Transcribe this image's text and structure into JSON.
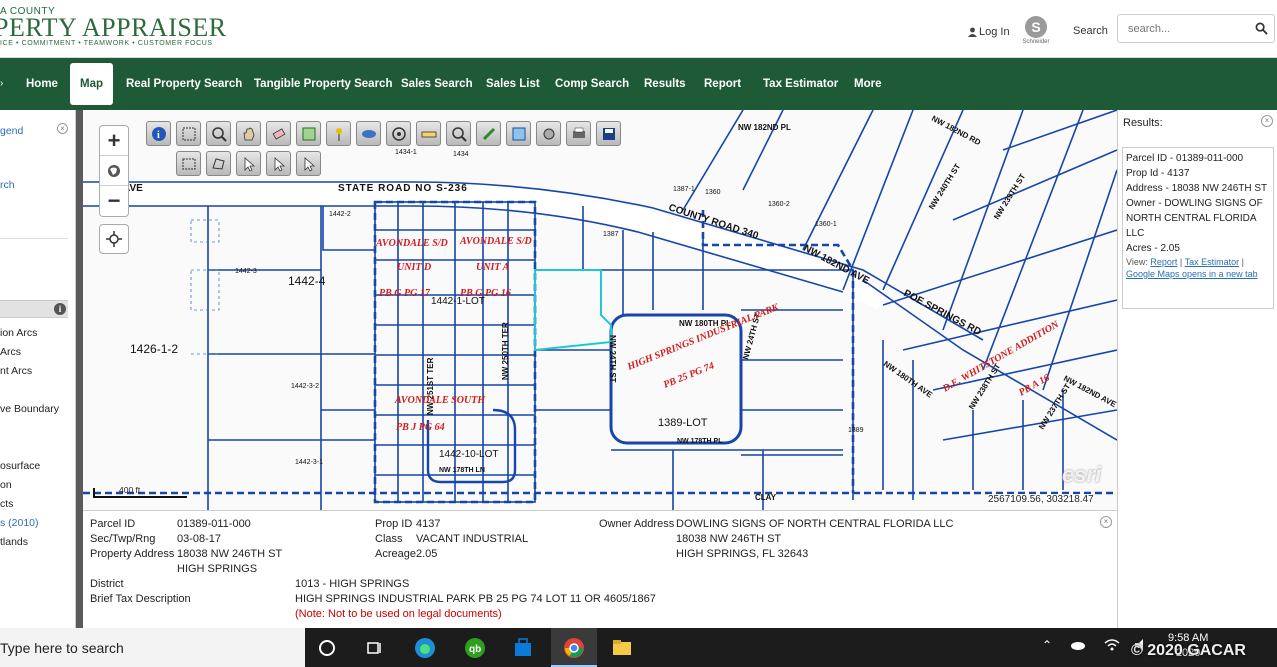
{
  "header": {
    "county": "A COUNTY",
    "title": "PERTY APPRAISER",
    "tagline": "ICE • COMMITMENT • TEAMWORK • CUSTOMER FOCUS",
    "login_label": "Log In",
    "search_label": "Search",
    "search_placeholder": "search..."
  },
  "nav": {
    "items": [
      "Home",
      "Map",
      "Real Property Search",
      "Tangible Property Search",
      "Sales Search",
      "Sales List",
      "Comp Search",
      "Results",
      "Report",
      "Tax Estimator",
      "More"
    ],
    "active": "Map"
  },
  "left_panel": {
    "items": [
      "gend",
      "rch",
      "ion Arcs",
      "Arcs",
      "nt Arcs",
      "ve Boundary",
      "osurface",
      "on",
      "cts",
      "s (2010)",
      "tlands"
    ]
  },
  "map": {
    "scale_label": "400 ft",
    "coordinates": "2567109.56, 303218.47",
    "attribution": "esri",
    "street_labels": [
      "STATE ROAD NO S-236",
      "COUNTY ROAD 340",
      "NW 182ND AVE",
      "POE SPRINGS RD",
      "NW 180TH PL",
      "NW 24TH ST",
      "NW 24TH ST",
      "NW 178TH PL",
      "NW 251ST TER",
      "NW 250TH TER",
      "NW 178TH LN",
      "NW 182ND PL",
      "NW 180TH AVE",
      "NW 182ND RD",
      "NW 240TH ST",
      "NW 239TH ST",
      "NW 238TH ST",
      "NW 237TH ST",
      "NW 182ND AVE",
      "AVE",
      "CLAY"
    ],
    "subdivision_labels": [
      "AVONDALE S/D",
      "AVONDALE S/D",
      "UNIT D",
      "UNIT A",
      "PB G PG 17",
      "PB G PG 16",
      "AVONDALE SOUTH",
      "PB J PG 64",
      "HIGH SPRINGS INDUSTRIAL PARK",
      "PB 25 PG 74",
      "D.E. WHITSTONE ADDITION",
      "PB A 16"
    ],
    "parcel_labels": [
      "1442-4",
      "1426-1-2",
      "1442-1-LOT",
      "1442-10-LOT",
      "1389-LOT",
      "1442-3",
      "1442-3-2",
      "1442-3-1",
      "1387",
      "1387-1",
      "1360",
      "1360-2",
      "1360-1",
      "1434-1",
      "1434",
      "1442-2",
      "1389"
    ]
  },
  "results": {
    "title": "Results:",
    "parcel_id": "Parcel ID - 01389-011-000",
    "prop_id": "Prop Id - 4137",
    "address": "Address - 18038 NW 246TH ST",
    "owner": "Owner - DOWLING SIGNS OF NORTH CENTRAL FLORIDA LLC",
    "acres": "Acres - 2.05",
    "view_label": "View:",
    "link_report": "Report",
    "link_tax": "Tax Estimator",
    "link_maps": "Google Maps opens in a new tab"
  },
  "info": {
    "parcel_id_label": "Parcel ID",
    "parcel_id": "01389-011-000",
    "sec_label": "Sec/Twp/Rng",
    "sec": "03-08-17",
    "prop_addr_label": "Property Address",
    "prop_addr_1": "18038 NW 246TH ST",
    "prop_addr_2": "HIGH SPRINGS",
    "prop_id_label": "Prop ID",
    "prop_id": "4137",
    "class_label": "Class",
    "class": "VACANT INDUSTRIAL",
    "acreage_label": "Acreage",
    "acreage": "2.05",
    "owner_label": "Owner Address",
    "owner_1": "DOWLING SIGNS OF NORTH CENTRAL FLORIDA LLC",
    "owner_2": "18038 NW 246TH ST",
    "owner_3": "HIGH SPRINGS, FL 32643",
    "district_label": "District",
    "district": "1013 - HIGH SPRINGS",
    "brief_label": "Brief Tax Description",
    "brief": "HIGH SPRINGS INDUSTRIAL PARK PB 25 PG 74 LOT 11 OR 4605/1867",
    "note": "(Note: Not to be used on legal documents)"
  },
  "taskbar": {
    "search_placeholder": "Type here to search",
    "time": "9:58 AM",
    "date": "2020",
    "watermark": "© 2020 GACAR"
  },
  "colors": {
    "brand_green": "#1d5a35",
    "parcel_blue": "#1546a8",
    "label_red": "#d41a1a"
  }
}
